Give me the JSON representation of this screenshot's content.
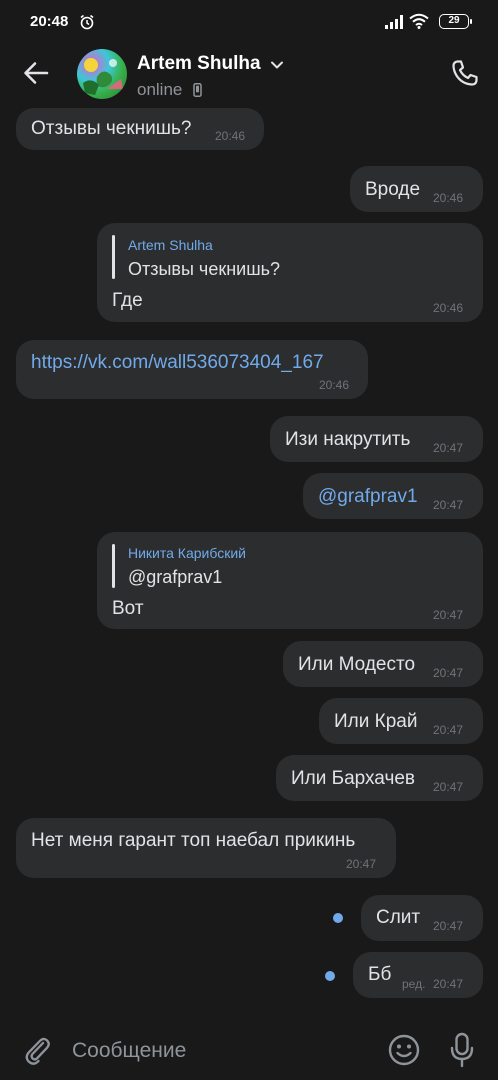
{
  "status_bar": {
    "time": "20:48",
    "battery": "29"
  },
  "header": {
    "name": "Artem Shulha",
    "status": "online"
  },
  "messages": [
    {
      "text": "Отзывы чекнишь?",
      "time": "20:46"
    },
    {
      "text": "Вроде",
      "time": "20:46"
    },
    {
      "reply_name": "Artem Shulha",
      "reply_text": "Отзывы чекнишь?",
      "text": "Где",
      "time": "20:46"
    },
    {
      "text": "https://vk.com/wall536073404_167",
      "time": "20:46"
    },
    {
      "text": "Изи накрутить",
      "time": "20:47"
    },
    {
      "text": "@grafprav1",
      "time": "20:47"
    },
    {
      "reply_name": "Никита Карибский",
      "reply_text": "@grafprav1",
      "text": "Вот",
      "time": "20:47"
    },
    {
      "text": "Или Модесто",
      "time": "20:47"
    },
    {
      "text": "Или Край",
      "time": "20:47"
    },
    {
      "text": "Или Бархачев",
      "time": "20:47"
    },
    {
      "text": "Нет меня гарант топ наебал прикинь",
      "time": "20:47"
    },
    {
      "text": "Слит",
      "time": "20:47"
    },
    {
      "text": "Бб",
      "edited": "ред.",
      "time": "20:47"
    }
  ],
  "composer": {
    "placeholder": "Сообщение"
  },
  "colors": {
    "background": "#19191a",
    "bubble": "#2c2d2e",
    "accent": "#71aaeb",
    "time_text": "#6f7379"
  },
  "icons": [
    "alarm-icon",
    "signal-icon",
    "wifi-icon",
    "battery-icon",
    "back-arrow-icon",
    "chevron-down-icon",
    "phone-status-icon",
    "call-icon",
    "attach-icon",
    "emoji-icon",
    "mic-icon"
  ]
}
